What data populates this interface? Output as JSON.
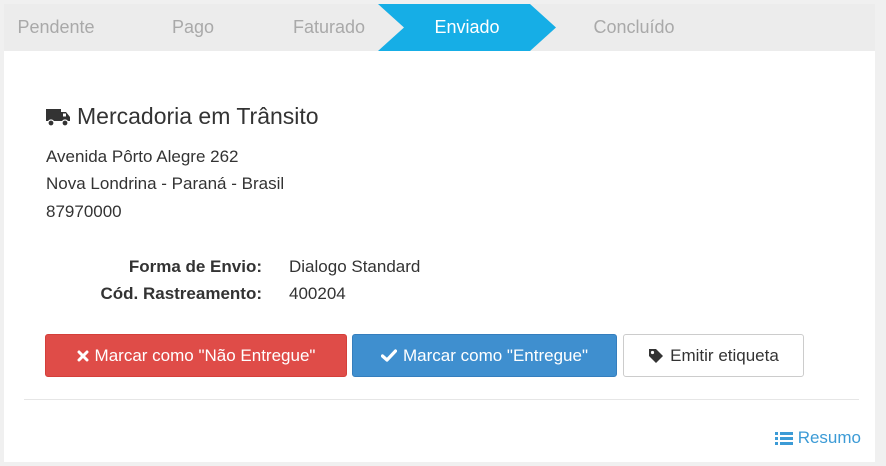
{
  "steps": {
    "items": [
      "Pendente",
      "Pago",
      "Faturado",
      "Enviado",
      "Concluído"
    ],
    "active_index": 3
  },
  "colors": {
    "active_step": "#16aee6",
    "danger": "#df4c48",
    "primary": "#3f8fcf",
    "link": "#3c9bd6"
  },
  "panel": {
    "title": "Mercadoria em Trânsito",
    "title_icon": "truck-icon",
    "address": {
      "line1": "Avenida Pôrto Alegre 262",
      "line2": "Nova Londrina - Paraná - Brasil",
      "postal_code": "87970000"
    },
    "shipping": {
      "method_label": "Forma de Envio:",
      "method_value": "Dialogo Standard",
      "tracking_label": "Cód. Rastreamento:",
      "tracking_value": "400204"
    },
    "buttons": {
      "not_delivered": "Marcar como \"Não Entregue\"",
      "delivered": "Marcar como \"Entregue\"",
      "label": "Emitir etiqueta"
    }
  },
  "footer": {
    "summary_link": "Resumo",
    "summary_icon": "list-icon"
  }
}
